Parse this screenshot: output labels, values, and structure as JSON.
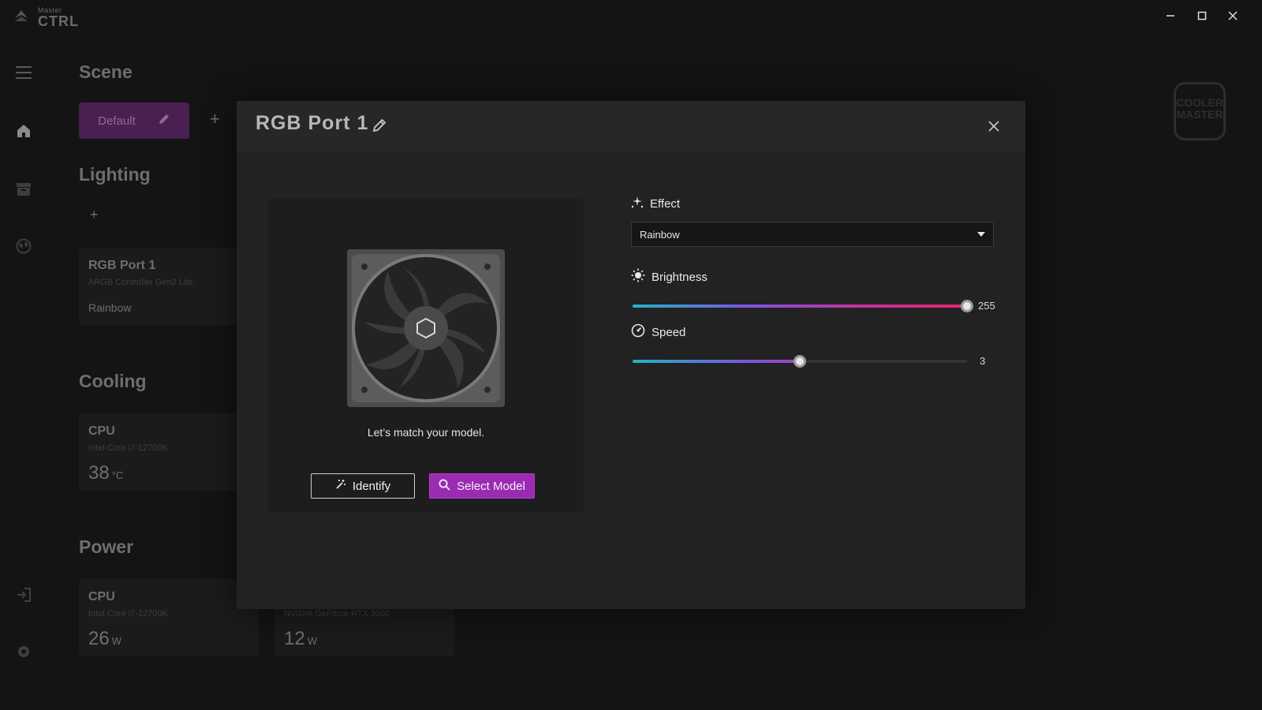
{
  "app": {
    "logo_small": "Master",
    "logo_big": "CTRL",
    "brand_mark": "COOLER MASTER"
  },
  "window_controls": [
    "minimize-icon",
    "maximize-icon",
    "close-icon"
  ],
  "nav_icons": [
    "menu-icon",
    "home-icon",
    "archive-icon",
    "globe-icon",
    "login-icon",
    "settings-icon"
  ],
  "background": {
    "scene_title": "Scene",
    "scene_pill_label": "Default",
    "lighting_title": "Lighting",
    "lighting_card": {
      "title": "RGB Port 1",
      "subtitle": "ARGB Controller Gen2 Lite",
      "effect": "Rainbow"
    },
    "cooling_title": "Cooling",
    "cooling_card": {
      "title": "CPU",
      "subtitle": "Intel Core i7-12700K",
      "value": "38",
      "unit": "°C"
    },
    "power_title": "Power",
    "power_card_cpu": {
      "title": "CPU",
      "subtitle": "Intel Core i7-12700K",
      "value": "26",
      "unit": "W"
    },
    "power_card_gpu": {
      "subtitle": "NVIDIA GeForce RTX 3060",
      "value": "12",
      "unit": "W"
    }
  },
  "modal": {
    "title": "RGB Port 1",
    "match_text": "Let’s match your model.",
    "identify_label": "Identify",
    "select_model_label": "Select Model",
    "effect": {
      "label": "Effect",
      "value": "Rainbow"
    },
    "brightness": {
      "label": "Brightness",
      "value": 255,
      "value_text": "255",
      "max": 255
    },
    "speed": {
      "label": "Speed",
      "value": 3,
      "value_text": "3",
      "max": 6
    }
  },
  "colors": {
    "accent_purple": "#9b2bb3",
    "slider_gradient": [
      "#1fb5c8",
      "#7a56e0",
      "#c2339f",
      "#e0286f"
    ]
  }
}
